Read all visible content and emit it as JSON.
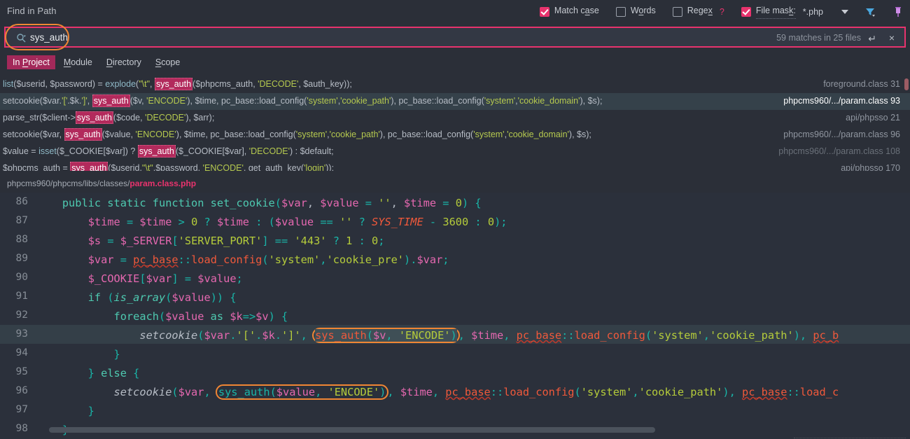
{
  "header": {
    "title": "Find in Path",
    "options": [
      {
        "id": "match-case",
        "label_pre": "Match c",
        "label_u": "a",
        "label_post": "se",
        "checked": true
      },
      {
        "id": "words",
        "label_pre": "W",
        "label_u": "o",
        "label_post": "rds",
        "checked": false
      },
      {
        "id": "regex",
        "label_pre": "Rege",
        "label_u": "x",
        "label_post": "",
        "checked": false,
        "help": "?"
      },
      {
        "id": "file-mask",
        "label_pre": "File mas",
        "label_u": "k",
        "label_post": ":",
        "checked": true
      }
    ],
    "file_mask_value": "*.php",
    "icons": [
      "filter-icon",
      "pin-icon"
    ]
  },
  "search": {
    "icon": "search-icon",
    "value": "sys_auth",
    "placeholder": "",
    "matches_text": "59 matches in 25 files",
    "enter_icon": "↵",
    "close_icon": "×",
    "accent_color": "#e8336d",
    "highlight_ring_color": "#f08634"
  },
  "scope_tabs": [
    {
      "label_pre": "In ",
      "label_u": "P",
      "label_post": "roject",
      "active": true
    },
    {
      "label_pre": "",
      "label_u": "M",
      "label_post": "odule",
      "active": false
    },
    {
      "label_pre": "",
      "label_u": "D",
      "label_post": "irectory",
      "active": false
    },
    {
      "label_pre": "",
      "label_u": "S",
      "label_post": "cope",
      "active": false
    }
  ],
  "results": [
    {
      "file": "foreground.class 31",
      "selected": false,
      "dim": false,
      "marker": true,
      "tokens": [
        {
          "t": "list",
          "c": "t-fn"
        },
        {
          "t": "($userid, $password) = ",
          "c": "t-def"
        },
        {
          "t": "explode",
          "c": "t-fn"
        },
        {
          "t": "(",
          "c": "t-def"
        },
        {
          "t": "\"\\t\"",
          "c": "t-str"
        },
        {
          "t": ", ",
          "c": "t-def"
        },
        {
          "t": "sys_auth",
          "c": "hl"
        },
        {
          "t": "($phpcms_auth, ",
          "c": "t-def"
        },
        {
          "t": "'DECODE'",
          "c": "t-str"
        },
        {
          "t": ", $auth_key));",
          "c": "t-def"
        }
      ]
    },
    {
      "file": "phpcms960/.../param.class 93",
      "selected": true,
      "dim": false,
      "marker": false,
      "tokens": [
        {
          "t": "setcookie($var.",
          "c": "t-def"
        },
        {
          "t": "'['",
          "c": "t-str"
        },
        {
          "t": ".$k.",
          "c": "t-def"
        },
        {
          "t": "']'",
          "c": "t-str"
        },
        {
          "t": ", ",
          "c": "t-def"
        },
        {
          "t": "sys_auth",
          "c": "hl"
        },
        {
          "t": "($v, ",
          "c": "t-def"
        },
        {
          "t": "'ENCODE'",
          "c": "t-str"
        },
        {
          "t": "), $time, pc_base::load_config(",
          "c": "t-def"
        },
        {
          "t": "'system'",
          "c": "t-str"
        },
        {
          "t": ",",
          "c": "t-def"
        },
        {
          "t": "'cookie_path'",
          "c": "t-str"
        },
        {
          "t": "), pc_base::load_config(",
          "c": "t-def"
        },
        {
          "t": "'system'",
          "c": "t-str"
        },
        {
          "t": ",",
          "c": "t-def"
        },
        {
          "t": "'cookie_domain'",
          "c": "t-str"
        },
        {
          "t": "), $s);",
          "c": "t-def"
        }
      ]
    },
    {
      "file": "api/phpsso 21",
      "selected": false,
      "dim": false,
      "marker": false,
      "tokens": [
        {
          "t": "parse_str($client->",
          "c": "t-def"
        },
        {
          "t": "sys_auth",
          "c": "hl"
        },
        {
          "t": "($code, ",
          "c": "t-def"
        },
        {
          "t": "'DECODE'",
          "c": "t-str"
        },
        {
          "t": "), $arr);",
          "c": "t-def"
        }
      ]
    },
    {
      "file": "phpcms960/.../param.class 96",
      "selected": false,
      "dim": false,
      "marker": false,
      "tokens": [
        {
          "t": "setcookie($var, ",
          "c": "t-def"
        },
        {
          "t": "sys_auth",
          "c": "hl"
        },
        {
          "t": "($value, ",
          "c": "t-def"
        },
        {
          "t": "'ENCODE'",
          "c": "t-str"
        },
        {
          "t": "), $time, pc_base::load_config(",
          "c": "t-def"
        },
        {
          "t": "'system'",
          "c": "t-str"
        },
        {
          "t": ",",
          "c": "t-def"
        },
        {
          "t": "'cookie_path'",
          "c": "t-str"
        },
        {
          "t": "), pc_base::load_config(",
          "c": "t-def"
        },
        {
          "t": "'system'",
          "c": "t-str"
        },
        {
          "t": ",",
          "c": "t-def"
        },
        {
          "t": "'cookie_domain'",
          "c": "t-str"
        },
        {
          "t": "), $s);",
          "c": "t-def"
        }
      ]
    },
    {
      "file": "phpcms960/.../param.class 108",
      "selected": false,
      "dim": true,
      "marker": false,
      "tokens": [
        {
          "t": "$value = ",
          "c": "t-def"
        },
        {
          "t": "isset",
          "c": "t-fn"
        },
        {
          "t": "($_COOKIE[$var]) ? ",
          "c": "t-def"
        },
        {
          "t": "sys_auth",
          "c": "hl"
        },
        {
          "t": "($_COOKIE[$var], ",
          "c": "t-def"
        },
        {
          "t": "'DECODE'",
          "c": "t-str"
        },
        {
          "t": ") : $default;",
          "c": "t-def"
        }
      ]
    },
    {
      "file": "api/phpsso 170",
      "selected": false,
      "dim": false,
      "marker": false,
      "tokens": [
        {
          "t": "$phpcms_auth = ",
          "c": "t-def"
        },
        {
          "t": "sys_auth",
          "c": "hl"
        },
        {
          "t": "($userid.",
          "c": "t-def"
        },
        {
          "t": "\"\\t\"",
          "c": "t-str"
        },
        {
          "t": ".$password, ",
          "c": "t-def"
        },
        {
          "t": "'ENCODE'",
          "c": "t-str"
        },
        {
          "t": ", get_auth_key(",
          "c": "t-def"
        },
        {
          "t": "'login'",
          "c": "t-str"
        },
        {
          "t": "));",
          "c": "t-def"
        }
      ]
    }
  ],
  "breadcrumb": {
    "path": "phpcms960/phpcms/libs/classes/",
    "filename": "param.class.php"
  },
  "editor": {
    "scrollbar_visible": true,
    "lines": [
      {
        "num": "86",
        "selected": false,
        "tokens": [
          {
            "t": "    ",
            "c": "c-pl"
          },
          {
            "t": "public static function ",
            "c": "c-kw"
          },
          {
            "t": "set_cookie",
            "c": "c-fn"
          },
          {
            "t": "(",
            "c": "c-op"
          },
          {
            "t": "$var",
            "c": "c-var"
          },
          {
            "t": ", ",
            "c": "c-pl"
          },
          {
            "t": "$value",
            "c": "c-var"
          },
          {
            "t": " = ",
            "c": "c-op"
          },
          {
            "t": "''",
            "c": "c-str"
          },
          {
            "t": ", ",
            "c": "c-pl"
          },
          {
            "t": "$time",
            "c": "c-var"
          },
          {
            "t": " = ",
            "c": "c-op"
          },
          {
            "t": "0",
            "c": "c-num"
          },
          {
            "t": ") {",
            "c": "c-op"
          }
        ]
      },
      {
        "num": "87",
        "selected": false,
        "tokens": [
          {
            "t": "        ",
            "c": "c-pl"
          },
          {
            "t": "$time",
            "c": "c-var"
          },
          {
            "t": " = ",
            "c": "c-op"
          },
          {
            "t": "$time",
            "c": "c-var"
          },
          {
            "t": " > ",
            "c": "c-op"
          },
          {
            "t": "0",
            "c": "c-num"
          },
          {
            "t": " ? ",
            "c": "c-op"
          },
          {
            "t": "$time",
            "c": "c-var"
          },
          {
            "t": " : (",
            "c": "c-op"
          },
          {
            "t": "$value",
            "c": "c-var"
          },
          {
            "t": " == ",
            "c": "c-op"
          },
          {
            "t": "''",
            "c": "c-str"
          },
          {
            "t": " ? ",
            "c": "c-op"
          },
          {
            "t": "SYS_TIME",
            "c": "c-const"
          },
          {
            "t": " - ",
            "c": "c-op"
          },
          {
            "t": "3600",
            "c": "c-num"
          },
          {
            "t": " : ",
            "c": "c-op"
          },
          {
            "t": "0",
            "c": "c-num"
          },
          {
            "t": ");",
            "c": "c-op"
          }
        ]
      },
      {
        "num": "88",
        "selected": false,
        "tokens": [
          {
            "t": "        ",
            "c": "c-pl"
          },
          {
            "t": "$s",
            "c": "c-var"
          },
          {
            "t": " = ",
            "c": "c-op"
          },
          {
            "t": "$_SERVER",
            "c": "c-var"
          },
          {
            "t": "[",
            "c": "c-op"
          },
          {
            "t": "'SERVER_PORT'",
            "c": "c-str"
          },
          {
            "t": "] == ",
            "c": "c-op"
          },
          {
            "t": "'443'",
            "c": "c-str"
          },
          {
            "t": " ? ",
            "c": "c-op"
          },
          {
            "t": "1",
            "c": "c-num"
          },
          {
            "t": " : ",
            "c": "c-op"
          },
          {
            "t": "0",
            "c": "c-num"
          },
          {
            "t": ";",
            "c": "c-op"
          }
        ]
      },
      {
        "num": "89",
        "selected": false,
        "tokens": [
          {
            "t": "        ",
            "c": "c-pl"
          },
          {
            "t": "$var",
            "c": "c-var"
          },
          {
            "t": " = ",
            "c": "c-op"
          },
          {
            "t": "pc_base",
            "c": "c-call c-err"
          },
          {
            "t": "::",
            "c": "c-op"
          },
          {
            "t": "load_config",
            "c": "c-call"
          },
          {
            "t": "(",
            "c": "c-op"
          },
          {
            "t": "'system'",
            "c": "c-str"
          },
          {
            "t": ",",
            "c": "c-op"
          },
          {
            "t": "'cookie_pre'",
            "c": "c-str"
          },
          {
            "t": ").",
            "c": "c-op"
          },
          {
            "t": "$var",
            "c": "c-var"
          },
          {
            "t": ";",
            "c": "c-op"
          }
        ]
      },
      {
        "num": "90",
        "selected": false,
        "tokens": [
          {
            "t": "        ",
            "c": "c-pl"
          },
          {
            "t": "$_COOKIE",
            "c": "c-var"
          },
          {
            "t": "[",
            "c": "c-op"
          },
          {
            "t": "$var",
            "c": "c-var"
          },
          {
            "t": "] = ",
            "c": "c-op"
          },
          {
            "t": "$value",
            "c": "c-var"
          },
          {
            "t": ";",
            "c": "c-op"
          }
        ]
      },
      {
        "num": "91",
        "selected": false,
        "tokens": [
          {
            "t": "        ",
            "c": "c-pl"
          },
          {
            "t": "if",
            "c": "c-kw"
          },
          {
            "t": " (",
            "c": "c-op"
          },
          {
            "t": "is_array",
            "c": "c-kw c-italic"
          },
          {
            "t": "(",
            "c": "c-op"
          },
          {
            "t": "$value",
            "c": "c-var"
          },
          {
            "t": ")) {",
            "c": "c-op"
          }
        ]
      },
      {
        "num": "92",
        "selected": false,
        "tokens": [
          {
            "t": "            ",
            "c": "c-pl"
          },
          {
            "t": "foreach",
            "c": "c-kw"
          },
          {
            "t": "(",
            "c": "c-op"
          },
          {
            "t": "$value",
            "c": "c-var"
          },
          {
            "t": " as ",
            "c": "c-kw"
          },
          {
            "t": "$k",
            "c": "c-var"
          },
          {
            "t": "=>",
            "c": "c-op"
          },
          {
            "t": "$v",
            "c": "c-var"
          },
          {
            "t": ") {",
            "c": "c-op"
          }
        ]
      },
      {
        "num": "93",
        "selected": true,
        "ring": true,
        "tokens_pre": [
          {
            "t": "                ",
            "c": "c-pl"
          },
          {
            "t": "setcookie",
            "c": "c-italic c-pl"
          },
          {
            "t": "(",
            "c": "c-op"
          },
          {
            "t": "$var",
            "c": "c-var"
          },
          {
            "t": ".",
            "c": "c-op"
          },
          {
            "t": "'['",
            "c": "c-str"
          },
          {
            "t": ".",
            "c": "c-op"
          },
          {
            "t": "$k",
            "c": "c-var"
          },
          {
            "t": ".",
            "c": "c-op"
          },
          {
            "t": "']'",
            "c": "c-str"
          },
          {
            "t": ", ",
            "c": "c-op"
          }
        ],
        "tokens_ring": [
          {
            "t": "sys_auth",
            "c": "c-call c-sel-hl"
          },
          {
            "t": "(",
            "c": "c-op c-sel-hl"
          },
          {
            "t": "$v",
            "c": "c-var c-sel-hl"
          },
          {
            "t": ", ",
            "c": "c-op c-sel-hl"
          },
          {
            "t": "'ENCODE'",
            "c": "c-str c-sel-hl"
          },
          {
            "t": ")",
            "c": "c-op c-sel-hl"
          }
        ],
        "tokens_post": [
          {
            "t": ", ",
            "c": "c-op"
          },
          {
            "t": "$time",
            "c": "c-var"
          },
          {
            "t": ", ",
            "c": "c-op"
          },
          {
            "t": "pc_base",
            "c": "c-call c-err"
          },
          {
            "t": "::",
            "c": "c-op"
          },
          {
            "t": "load_config",
            "c": "c-call"
          },
          {
            "t": "(",
            "c": "c-op"
          },
          {
            "t": "'system'",
            "c": "c-str"
          },
          {
            "t": ",",
            "c": "c-op"
          },
          {
            "t": "'cookie_path'",
            "c": "c-str"
          },
          {
            "t": "), ",
            "c": "c-op"
          },
          {
            "t": "pc_b",
            "c": "c-call c-err"
          }
        ]
      },
      {
        "num": "94",
        "selected": false,
        "tokens": [
          {
            "t": "            }",
            "c": "c-op"
          }
        ]
      },
      {
        "num": "95",
        "selected": false,
        "tokens": [
          {
            "t": "        } ",
            "c": "c-op"
          },
          {
            "t": "else",
            "c": "c-kw"
          },
          {
            "t": " {",
            "c": "c-op"
          }
        ]
      },
      {
        "num": "96",
        "selected": false,
        "ring": true,
        "tokens_pre": [
          {
            "t": "            ",
            "c": "c-pl"
          },
          {
            "t": "setcookie",
            "c": "c-italic c-pl"
          },
          {
            "t": "(",
            "c": "c-op"
          },
          {
            "t": "$var",
            "c": "c-var"
          },
          {
            "t": ", ",
            "c": "c-op"
          }
        ],
        "tokens_ring": [
          {
            "t": "sys_auth",
            "c": "c-op"
          },
          {
            "t": "(",
            "c": "c-op"
          },
          {
            "t": "$value",
            "c": "c-var"
          },
          {
            "t": ", ",
            "c": "c-op"
          },
          {
            "t": "'ENCODE'",
            "c": "c-str"
          },
          {
            "t": ")",
            "c": "c-op"
          }
        ],
        "tokens_post": [
          {
            "t": ", ",
            "c": "c-op"
          },
          {
            "t": "$time",
            "c": "c-var"
          },
          {
            "t": ", ",
            "c": "c-op"
          },
          {
            "t": "pc_base",
            "c": "c-call c-err"
          },
          {
            "t": "::",
            "c": "c-op"
          },
          {
            "t": "load_config",
            "c": "c-call"
          },
          {
            "t": "(",
            "c": "c-op"
          },
          {
            "t": "'system'",
            "c": "c-str"
          },
          {
            "t": ",",
            "c": "c-op"
          },
          {
            "t": "'cookie_path'",
            "c": "c-str"
          },
          {
            "t": "), ",
            "c": "c-op"
          },
          {
            "t": "pc_base",
            "c": "c-call c-err"
          },
          {
            "t": "::",
            "c": "c-op"
          },
          {
            "t": "load_c",
            "c": "c-call"
          }
        ]
      },
      {
        "num": "97",
        "selected": false,
        "tokens": [
          {
            "t": "        }",
            "c": "c-op"
          }
        ]
      },
      {
        "num": "98",
        "selected": false,
        "tokens": [
          {
            "t": "    }",
            "c": "c-op"
          }
        ]
      }
    ]
  }
}
